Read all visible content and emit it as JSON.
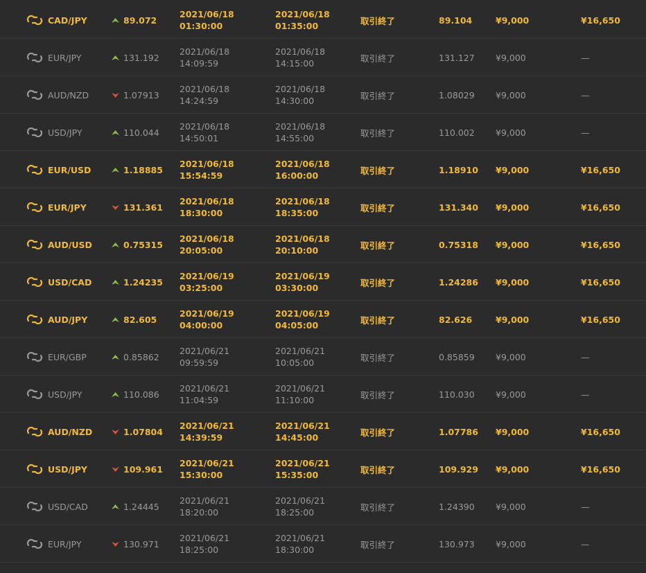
{
  "colors": {
    "win": "#f0b93a",
    "neutral": "#9a9a9a",
    "up": "#8bc34a",
    "down": "#e5533c",
    "background": "#2b2b2b"
  },
  "icons": {
    "pair_icon": "exchange-arrows-icon",
    "up_icon": "arrow-up-icon",
    "down_icon": "arrow-down-icon"
  },
  "rows": [
    {
      "result": "win",
      "pair": "CAD/JPY",
      "direction": "up",
      "entry": "89.072",
      "open_date": "2021/06/18",
      "open_time": "01:30:00",
      "close_date": "2021/06/18",
      "close_time": "01:35:00",
      "status": "取引終了",
      "exit": "89.104",
      "amount": "¥9,000",
      "payout": "¥16,650"
    },
    {
      "result": "lose",
      "pair": "EUR/JPY",
      "direction": "up",
      "entry": "131.192",
      "open_date": "2021/06/18",
      "open_time": "14:09:59",
      "close_date": "2021/06/18",
      "close_time": "14:15:00",
      "status": "取引終了",
      "exit": "131.127",
      "amount": "¥9,000",
      "payout": "—"
    },
    {
      "result": "lose",
      "pair": "AUD/NZD",
      "direction": "down",
      "entry": "1.07913",
      "open_date": "2021/06/18",
      "open_time": "14:24:59",
      "close_date": "2021/06/18",
      "close_time": "14:30:00",
      "status": "取引終了",
      "exit": "1.08029",
      "amount": "¥9,000",
      "payout": "—"
    },
    {
      "result": "lose",
      "pair": "USD/JPY",
      "direction": "up",
      "entry": "110.044",
      "open_date": "2021/06/18",
      "open_time": "14:50:01",
      "close_date": "2021/06/18",
      "close_time": "14:55:00",
      "status": "取引終了",
      "exit": "110.002",
      "amount": "¥9,000",
      "payout": "—"
    },
    {
      "result": "win",
      "pair": "EUR/USD",
      "direction": "up",
      "entry": "1.18885",
      "open_date": "2021/06/18",
      "open_time": "15:54:59",
      "close_date": "2021/06/18",
      "close_time": "16:00:00",
      "status": "取引終了",
      "exit": "1.18910",
      "amount": "¥9,000",
      "payout": "¥16,650"
    },
    {
      "result": "win",
      "pair": "EUR/JPY",
      "direction": "down",
      "entry": "131.361",
      "open_date": "2021/06/18",
      "open_time": "18:30:00",
      "close_date": "2021/06/18",
      "close_time": "18:35:00",
      "status": "取引終了",
      "exit": "131.340",
      "amount": "¥9,000",
      "payout": "¥16,650"
    },
    {
      "result": "win",
      "pair": "AUD/USD",
      "direction": "up",
      "entry": "0.75315",
      "open_date": "2021/06/18",
      "open_time": "20:05:00",
      "close_date": "2021/06/18",
      "close_time": "20:10:00",
      "status": "取引終了",
      "exit": "0.75318",
      "amount": "¥9,000",
      "payout": "¥16,650"
    },
    {
      "result": "win",
      "pair": "USD/CAD",
      "direction": "up",
      "entry": "1.24235",
      "open_date": "2021/06/19",
      "open_time": "03:25:00",
      "close_date": "2021/06/19",
      "close_time": "03:30:00",
      "status": "取引終了",
      "exit": "1.24286",
      "amount": "¥9,000",
      "payout": "¥16,650"
    },
    {
      "result": "win",
      "pair": "AUD/JPY",
      "direction": "up",
      "entry": "82.605",
      "open_date": "2021/06/19",
      "open_time": "04:00:00",
      "close_date": "2021/06/19",
      "close_time": "04:05:00",
      "status": "取引終了",
      "exit": "82.626",
      "amount": "¥9,000",
      "payout": "¥16,650"
    },
    {
      "result": "lose",
      "pair": "EUR/GBP",
      "direction": "up",
      "entry": "0.85862",
      "open_date": "2021/06/21",
      "open_time": "09:59:59",
      "close_date": "2021/06/21",
      "close_time": "10:05:00",
      "status": "取引終了",
      "exit": "0.85859",
      "amount": "¥9,000",
      "payout": "—"
    },
    {
      "result": "lose",
      "pair": "USD/JPY",
      "direction": "up",
      "entry": "110.086",
      "open_date": "2021/06/21",
      "open_time": "11:04:59",
      "close_date": "2021/06/21",
      "close_time": "11:10:00",
      "status": "取引終了",
      "exit": "110.030",
      "amount": "¥9,000",
      "payout": "—"
    },
    {
      "result": "win",
      "pair": "AUD/NZD",
      "direction": "down",
      "entry": "1.07804",
      "open_date": "2021/06/21",
      "open_time": "14:39:59",
      "close_date": "2021/06/21",
      "close_time": "14:45:00",
      "status": "取引終了",
      "exit": "1.07786",
      "amount": "¥9,000",
      "payout": "¥16,650"
    },
    {
      "result": "win",
      "pair": "USD/JPY",
      "direction": "down",
      "entry": "109.961",
      "open_date": "2021/06/21",
      "open_time": "15:30:00",
      "close_date": "2021/06/21",
      "close_time": "15:35:00",
      "status": "取引終了",
      "exit": "109.929",
      "amount": "¥9,000",
      "payout": "¥16,650"
    },
    {
      "result": "lose",
      "pair": "USD/CAD",
      "direction": "up",
      "entry": "1.24445",
      "open_date": "2021/06/21",
      "open_time": "18:20:00",
      "close_date": "2021/06/21",
      "close_time": "18:25:00",
      "status": "取引終了",
      "exit": "1.24390",
      "amount": "¥9,000",
      "payout": "—"
    },
    {
      "result": "lose",
      "pair": "EUR/JPY",
      "direction": "down",
      "entry": "130.971",
      "open_date": "2021/06/21",
      "open_time": "18:25:00",
      "close_date": "2021/06/21",
      "close_time": "18:30:00",
      "status": "取引終了",
      "exit": "130.973",
      "amount": "¥9,000",
      "payout": "—"
    }
  ]
}
